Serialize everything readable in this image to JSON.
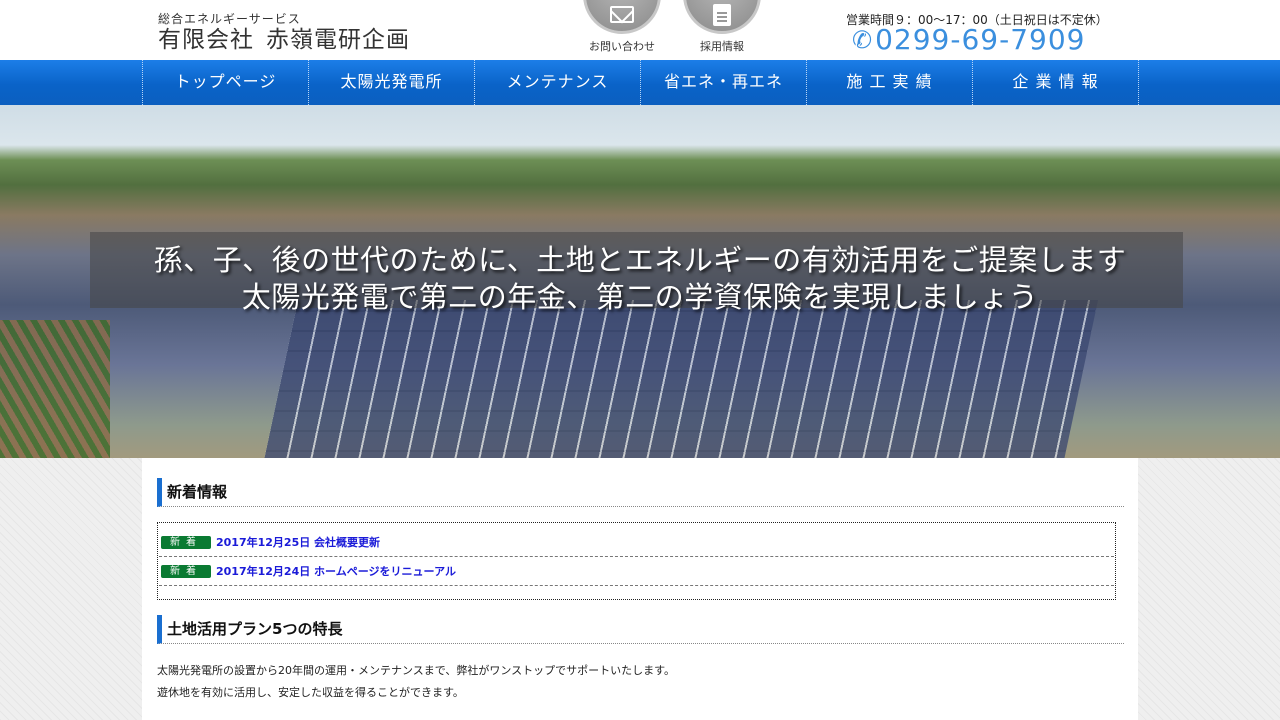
{
  "header": {
    "logo_sub": "総合エネルギーサービス",
    "logo_company_type": "有限会社",
    "logo_company_name": "赤嶺電研企画",
    "contact_label": "お問い合わせ",
    "recruit_label": "採用情報",
    "business_hours": "営業時間９：00～17：00（土日祝日は不定休）",
    "phone": "0299-69-7909",
    "icons": {
      "contact": "mail-icon",
      "recruit": "document-icon",
      "phone": "phone-icon"
    }
  },
  "nav": {
    "items": [
      {
        "label": "トップページ"
      },
      {
        "label": "太陽光発電所"
      },
      {
        "label": "メンテナンス"
      },
      {
        "label": "省エネ・再エネ"
      },
      {
        "label": "施 工 実 績"
      },
      {
        "label": "企 業 情 報"
      }
    ]
  },
  "hero": {
    "line1": "孫、子、後の世代のために、土地とエネルギーの有効活用をご提案します",
    "line2": "太陽光発電で第二の年金、第二の学資保険を実現しましょう"
  },
  "news": {
    "title": "新着情報",
    "badge": "新着",
    "items": [
      {
        "text": "2017年12月25日 会社概要更新"
      },
      {
        "text": "2017年12月24日 ホームページをリニューアル"
      }
    ]
  },
  "plan": {
    "title": "土地活用プラン5つの特長",
    "line1": "太陽光発電所の設置から20年間の運用・メンテナンスまで、弊社がワンストップでサポートいたします。",
    "line2": "遊休地を有効に活用し、安定した収益を得ることができます。"
  },
  "colors": {
    "nav": "#0a63c8",
    "accent": "#1a6fd0",
    "phone": "#3b8fde",
    "news_badge": "#0a7a32",
    "news_link": "#1a1ad8"
  }
}
